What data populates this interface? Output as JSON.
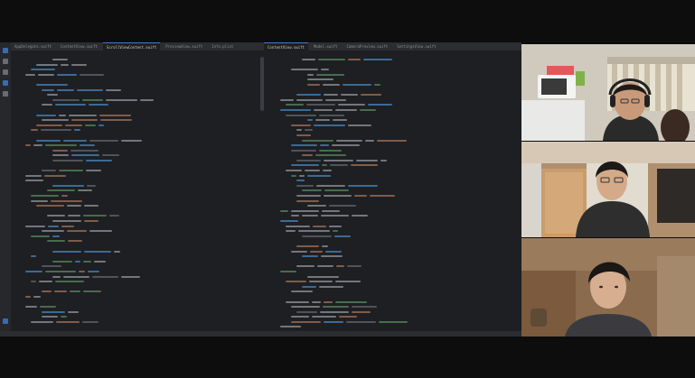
{
  "colors": {
    "editor_bg": "#1e1f22",
    "panel_bg": "#2b2d30",
    "accent": "#3d7bd8",
    "keyword": "#cf8e6d",
    "string": "#6aab73",
    "function": "#56a8f5",
    "comment": "#7a7e85",
    "plain": "#bcbec4"
  },
  "left_editor": {
    "tabs": [
      "AppDelegate.swift",
      "ContentView.swift",
      "ScrollViewContent.swift",
      "PreviewView.swift",
      "Info.plist"
    ],
    "active_tab_index": 2
  },
  "right_editor": {
    "tabs": [
      "ContentView.swift",
      "Model.swift",
      "CameraPreview.swift",
      "SettingsView.swift"
    ],
    "active_tab_index": 0
  },
  "video_call": {
    "participants": [
      {
        "icon": "webcam-feed-participant-1"
      },
      {
        "icon": "webcam-feed-participant-2"
      },
      {
        "icon": "webcam-feed-participant-3"
      }
    ]
  }
}
